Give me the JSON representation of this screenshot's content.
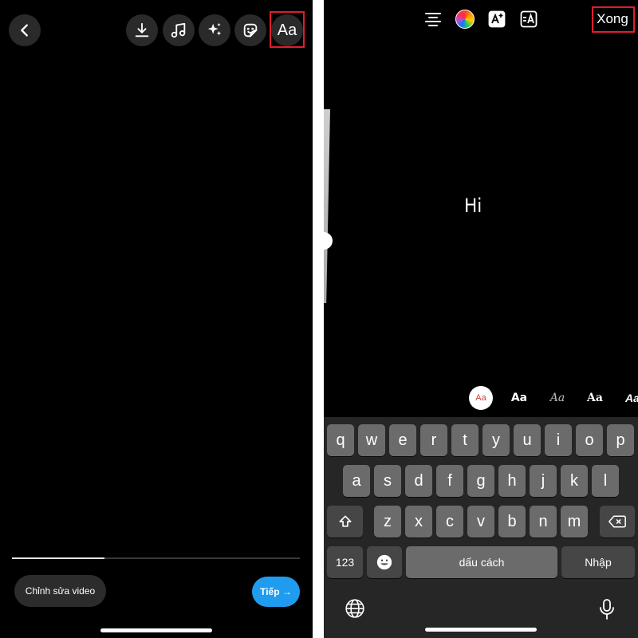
{
  "left": {
    "toolbar": {
      "text_tool_label": "Aa"
    },
    "progress_fraction": 0.32,
    "edit_video_label": "Chỉnh sửa video",
    "next_label": "Tiếp →"
  },
  "right": {
    "done_label": "Xong",
    "canvas_text": "Hi",
    "font_styles": [
      "Aa",
      "Aa",
      "Aa",
      "Aa",
      "Aa"
    ],
    "keyboard": {
      "row1": [
        "q",
        "w",
        "e",
        "r",
        "t",
        "y",
        "u",
        "i",
        "o",
        "p"
      ],
      "row2": [
        "a",
        "s",
        "d",
        "f",
        "g",
        "h",
        "j",
        "k",
        "l"
      ],
      "row3": [
        "z",
        "x",
        "c",
        "v",
        "b",
        "n",
        "m"
      ],
      "numbers_label": "123",
      "space_label": "dấu cách",
      "return_label": "Nhập"
    }
  },
  "colors": {
    "highlight": "#e11d2a",
    "next_button": "#1f9cf0",
    "background": "#000000"
  }
}
